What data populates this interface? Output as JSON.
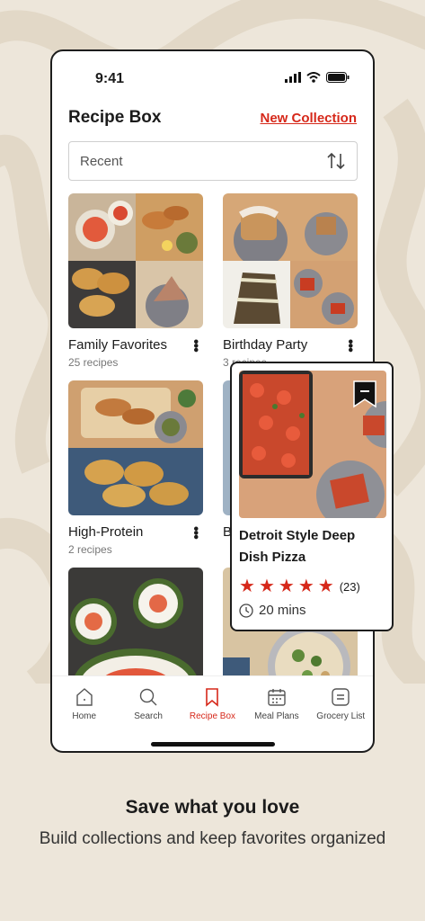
{
  "status_bar": {
    "time": "9:41"
  },
  "header": {
    "title": "Recipe Box",
    "new_collection": "New Collection"
  },
  "sort": {
    "value": "Recent"
  },
  "collections": [
    {
      "title": "Family Favorites",
      "count": "25 recipes"
    },
    {
      "title": "Birthday Party",
      "count": "3 recipes"
    },
    {
      "title": "High-Protein",
      "count": "2 recipes"
    },
    {
      "title": "B",
      "count": ""
    }
  ],
  "popup": {
    "title": "Detroit Style Deep Dish Pizza",
    "rating": 5,
    "reviews": "(23)",
    "time": "20 mins"
  },
  "nav": [
    {
      "label": "Home",
      "icon": "home-icon"
    },
    {
      "label": "Search",
      "icon": "search-icon"
    },
    {
      "label": "Recipe Box",
      "icon": "bookmark-icon",
      "active": true
    },
    {
      "label": "Meal Plans",
      "icon": "calendar-icon"
    },
    {
      "label": "Grocery List",
      "icon": "list-icon"
    }
  ],
  "marketing": {
    "tagline": "Save what you love",
    "subline": "Build collections and keep favorites organized"
  },
  "colors": {
    "accent": "#d6281a",
    "background": "#ede6da"
  }
}
